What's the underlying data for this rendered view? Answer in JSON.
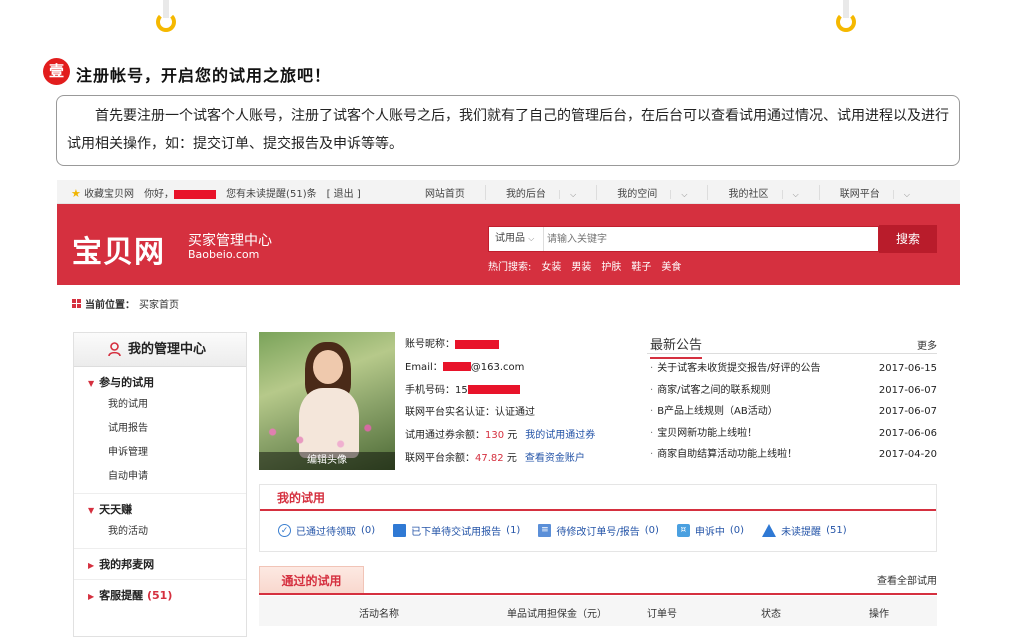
{
  "step": {
    "badge": "壹",
    "title": "注册帐号，开启您的试用之旅吧！",
    "intro": "首先要注册一个试客个人账号，注册了试客个人账号之后，我们就有了自己的管理后台，在后台可以查看试用通过情况、试用进程以及进行试用相关操作，如：提交订单、提交报告及申诉等等。"
  },
  "topbar": {
    "favorite": "收藏宝贝网",
    "hello": "你好，",
    "unread": "您有未读提醒(51)条",
    "logout": "[ 退出 ]",
    "links": [
      "网站首页",
      "我的后台",
      "我的空间",
      "我的社区",
      "联网平台"
    ]
  },
  "header": {
    "logo": "宝贝网",
    "subtitle": "买家管理中心",
    "url": "Baobeio.com",
    "search_category": "试用品",
    "search_placeholder": "请输入关键字",
    "search_button": "搜索",
    "hot_label": "热门搜索:",
    "hot_items": [
      "女装",
      "男装",
      "护肤",
      "鞋子",
      "美食"
    ]
  },
  "breadcrumb": {
    "label": "当前位置：",
    "current": "买家首页"
  },
  "sidebar": {
    "title": "我的管理中心",
    "groups": [
      {
        "title": "参与的试用",
        "items": [
          "我的试用",
          "试用报告",
          "申诉管理",
          "自动申请"
        ]
      },
      {
        "title": "天天赚",
        "items": [
          "我的活动"
        ]
      },
      {
        "title": "我的邦麦网",
        "items": []
      },
      {
        "title": "客服提醒",
        "count": "(51)",
        "items": []
      }
    ]
  },
  "avatar": {
    "edit_label": "编辑头像"
  },
  "profile": {
    "nick_label": "账号昵称：",
    "email_label": "Email：",
    "email_suffix": "@163.com",
    "phone_label": "手机号码：",
    "phone_prefix": "15",
    "verify_label": "联网平台实名认证：",
    "verify_value": "认证通过",
    "coupon_label": "试用通过券余额：",
    "coupon_value": "130",
    "coupon_unit": "元",
    "coupon_link": "我的试用通过券",
    "balance_label": "联网平台余额：",
    "balance_value": "47.82",
    "balance_unit": "元",
    "balance_link": "查看资金账户"
  },
  "notice": {
    "title": "最新公告",
    "more": "更多",
    "items": [
      {
        "text": "关于试客未收货提交报告/好评的公告",
        "date": "2017-06-15"
      },
      {
        "text": "商家/试客之间的联系规则",
        "date": "2017-06-07"
      },
      {
        "text": "B产品上线规则（AB活动）",
        "date": "2017-06-07"
      },
      {
        "text": "宝贝网新功能上线啦！",
        "date": "2017-06-06"
      },
      {
        "text": "商家自助结算活动功能上线啦！",
        "date": "2017-04-20"
      }
    ]
  },
  "mytrial": {
    "title": "我的试用",
    "stats": [
      {
        "label": "已通过待领取",
        "count": "(0)",
        "icon": "check-circle-icon"
      },
      {
        "label": "已下单待交试用报告",
        "count": "(1)",
        "icon": "book-icon"
      },
      {
        "label": "待修改订单号/报告",
        "count": "(0)",
        "icon": "edit-list-icon"
      },
      {
        "label": "申诉中",
        "count": "(0)",
        "icon": "appeal-doc-icon"
      },
      {
        "label": "未读提醒",
        "count": "(51)",
        "icon": "warning-icon"
      }
    ]
  },
  "passed": {
    "title": "通过的试用",
    "view_all": "查看全部试用",
    "columns": [
      "活动名称",
      "单品试用担保金（元）",
      "订单号",
      "状态",
      "操作"
    ]
  },
  "colors": {
    "brand": "#d5303f",
    "link": "#2555a8",
    "badge": "#e21d1d"
  }
}
